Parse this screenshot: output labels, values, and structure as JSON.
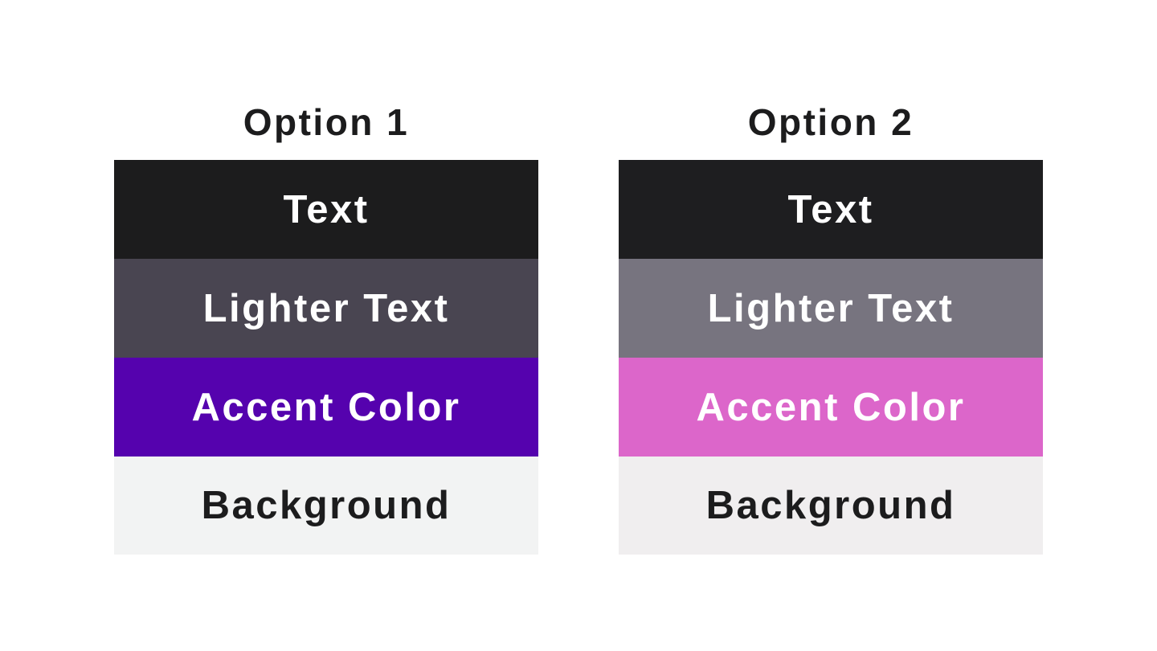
{
  "options": [
    {
      "title": "Option 1",
      "swatches": [
        {
          "label": "Text",
          "color": "#1c1c1d",
          "text_color": "#ffffff"
        },
        {
          "label": "Lighter Text",
          "color": "#494551",
          "text_color": "#ffffff"
        },
        {
          "label": "Accent Color",
          "color": "#5502ae",
          "text_color": "#ffffff"
        },
        {
          "label": "Background",
          "color": "#f2f3f3",
          "text_color": "#1c1c1d"
        }
      ]
    },
    {
      "title": "Option 2",
      "swatches": [
        {
          "label": "Text",
          "color": "#1e1e20",
          "text_color": "#ffffff"
        },
        {
          "label": "Lighter Text",
          "color": "#77747f",
          "text_color": "#ffffff"
        },
        {
          "label": "Accent Color",
          "color": "#dc66ca",
          "text_color": "#ffffff"
        },
        {
          "label": "Background",
          "color": "#f0eeef",
          "text_color": "#1c1c1d"
        }
      ]
    }
  ]
}
